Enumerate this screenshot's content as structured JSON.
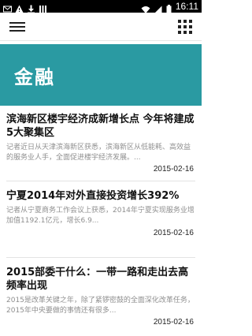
{
  "status_bar": {
    "time": "16:11",
    "icons_left": [
      "mail-icon",
      "warning-icon",
      "download-icon",
      "bars-icon"
    ],
    "icons_right": [
      "wifi-icon",
      "mobile-signal-icon",
      "battery-icon"
    ]
  },
  "app_bar": {
    "menu_icon": "hamburger-menu-icon",
    "apps_icon": "grid-apps-icon"
  },
  "banner": {
    "title": "金融",
    "color": "#2a9aa2"
  },
  "articles": [
    {
      "title": "滨海新区楼宇经济成新增长点 今年将建成5大聚集区",
      "summary": "记者近日从天津滨海新区获悉，滨海新区从低能耗、高效益的服务业人手，全面促进楼宇经济发展。...",
      "date": "2015-02-16"
    },
    {
      "title": "宁夏2014年对外直接投资增长392%",
      "summary": "记者从宁夏商务工作会议上获悉，2014年宁夏实现服务业增加值1192.1亿元，增长6.9...",
      "date": "2015-02-16"
    },
    {
      "title": "2015部委干什么：一带一路和走出去高频率出现",
      "summary": "2015是改革关键之年，除了紧锣密鼓的全面深化改革任务，2015年中央要做的事情还有很多...",
      "date": "2015-02-16"
    }
  ]
}
